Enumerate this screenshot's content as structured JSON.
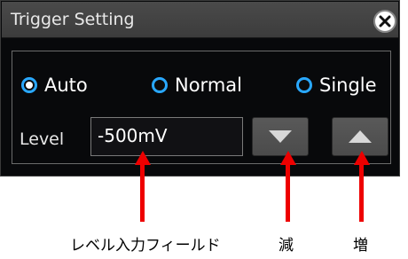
{
  "dialog": {
    "title": "Trigger Setting",
    "close_icon": "close-icon",
    "modes": [
      {
        "label": "Auto",
        "selected": true
      },
      {
        "label": "Normal",
        "selected": false
      },
      {
        "label": "Single",
        "selected": false
      }
    ],
    "level": {
      "label": "Level",
      "value": "-500mV",
      "decrease_icon": "triangle-down-icon",
      "increase_icon": "triangle-up-icon"
    }
  },
  "annotations": {
    "input_caption": "レベル入力フィールド",
    "decrease_caption": "減",
    "increase_caption": "増"
  },
  "colors": {
    "radio_accent": "#29a8ff",
    "annotation_arrow": "#ee0000",
    "dialog_bg": "#08090b"
  }
}
